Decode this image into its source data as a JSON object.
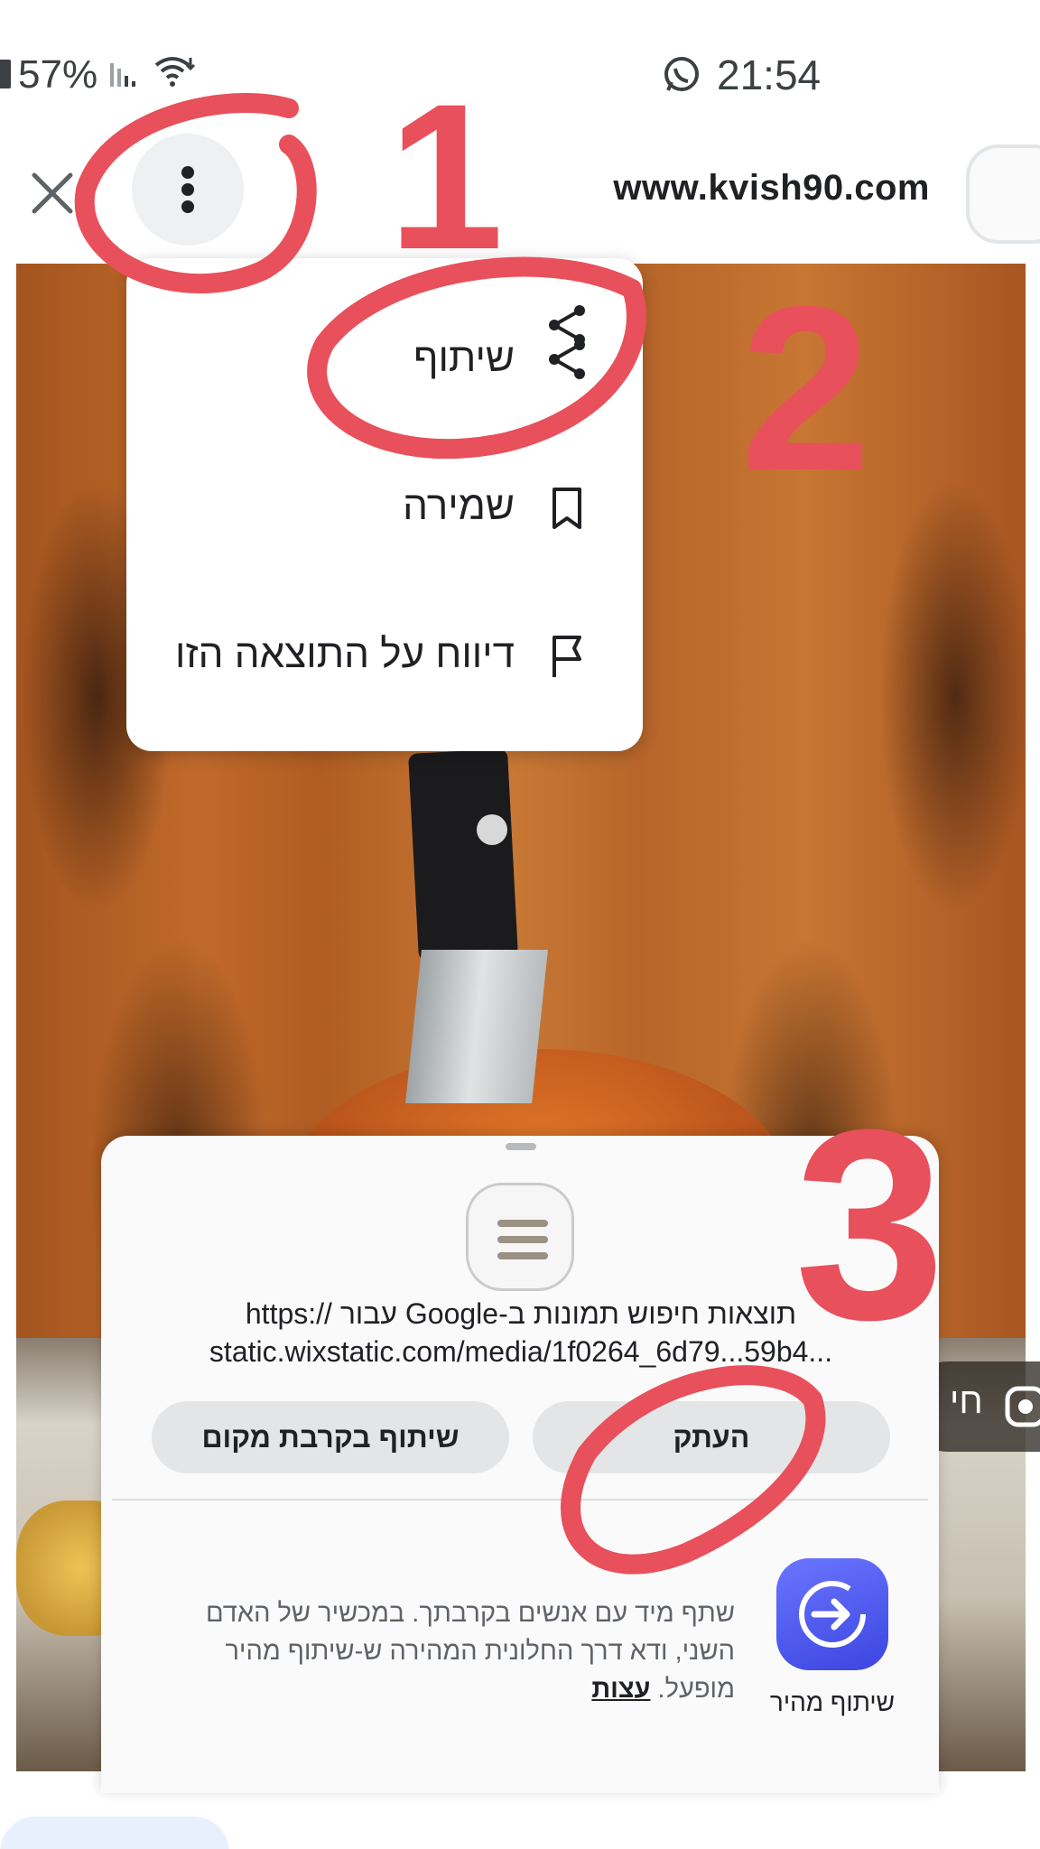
{
  "status_bar": {
    "battery": "57%",
    "time": "21:54"
  },
  "header": {
    "site": "www.kvish90.com"
  },
  "menu": {
    "items": [
      {
        "label": "שיתוף",
        "icon": "share-icon"
      },
      {
        "label": "שמירה",
        "icon": "bookmark-icon"
      },
      {
        "label": "דיווח על התוצאה הזו",
        "icon": "flag-icon"
      }
    ]
  },
  "share_sheet": {
    "title": "תוצאות חיפוש תמונות ב-Google עבור //:https",
    "url": "static.wixstatic.com/media/1f0264_6d79...59b4...",
    "copy_label": "העתק",
    "nearby_label": "שיתוף בקרבת מקום",
    "quick_share_label": "שיתוף מהיר",
    "quick_share_desc": "שתף מיד עם אנשים בקרבתך. במכשיר של האדם השני, ודא דרך החלונית המהירה ש-שיתוף מהיר מופעל.",
    "tips_label": "עצות"
  },
  "photo": {
    "lens_chip_text": "חי"
  },
  "annotations": {
    "labels": [
      "1",
      "2",
      "3"
    ],
    "color": "#e8505b"
  }
}
